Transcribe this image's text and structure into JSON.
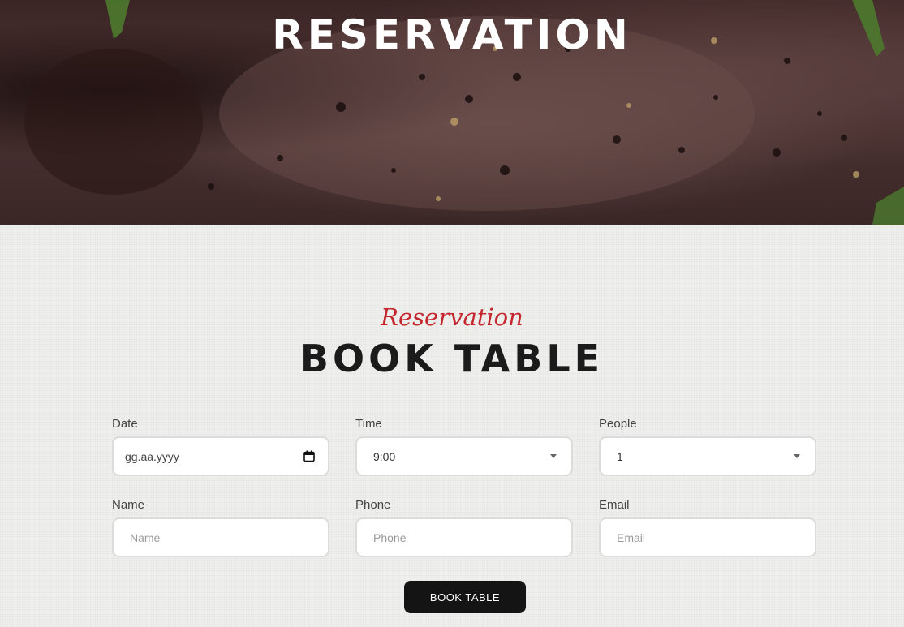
{
  "hero": {
    "title": "RESERVATION"
  },
  "section": {
    "subtitle": "Reservation",
    "title": "BOOK TABLE"
  },
  "form": {
    "date": {
      "label": "Date",
      "placeholder": "gg.aa.yyyy"
    },
    "time": {
      "label": "Time",
      "value": "9:00"
    },
    "people": {
      "label": "People",
      "value": "1"
    },
    "name": {
      "label": "Name",
      "placeholder": "Name"
    },
    "phone": {
      "label": "Phone",
      "placeholder": "Phone"
    },
    "email": {
      "label": "Email",
      "placeholder": "Email"
    },
    "submit_label": "BOOK TABLE"
  },
  "colors": {
    "accent": "#c4262e",
    "button": "#141414",
    "background": "#efefed"
  },
  "icons": {
    "date": "calendar-icon",
    "select": "chevron-down-icon"
  }
}
